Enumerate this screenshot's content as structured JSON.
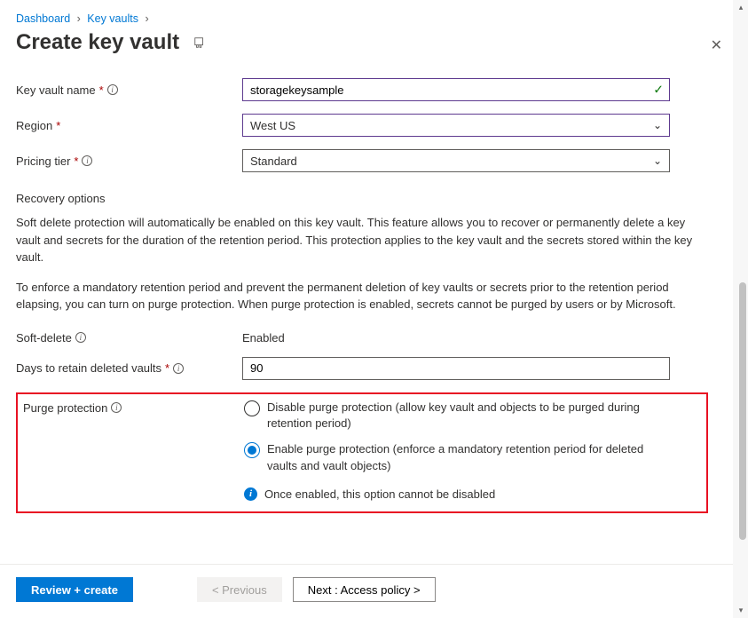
{
  "breadcrumb": {
    "item1": "Dashboard",
    "item2": "Key vaults"
  },
  "title": "Create key vault",
  "fields": {
    "name_label": "Key vault name",
    "name_value": "storagekeysample",
    "region_label": "Region",
    "region_value": "West US",
    "tier_label": "Pricing tier",
    "tier_value": "Standard",
    "softdelete_label": "Soft-delete",
    "softdelete_value": "Enabled",
    "days_label": "Days to retain deleted vaults",
    "days_value": "90",
    "purge_label": "Purge protection"
  },
  "recovery": {
    "heading": "Recovery options",
    "desc1": "Soft delete protection will automatically be enabled on this key vault. This feature allows you to recover or permanently delete a key vault and secrets for the duration of the retention period. This protection applies to the key vault and the secrets stored within the key vault.",
    "desc2": "To enforce a mandatory retention period and prevent the permanent deletion of key vaults or secrets prior to the retention period elapsing, you can turn on purge protection. When purge protection is enabled, secrets cannot be purged by users or by Microsoft."
  },
  "purge": {
    "option_disable": "Disable purge protection (allow key vault and objects to be purged during retention period)",
    "option_enable": "Enable purge protection (enforce a mandatory retention period for deleted vaults and vault objects)",
    "note": "Once enabled, this option cannot be disabled"
  },
  "footer": {
    "review": "Review + create",
    "prev": "< Previous",
    "next": "Next : Access policy >"
  }
}
